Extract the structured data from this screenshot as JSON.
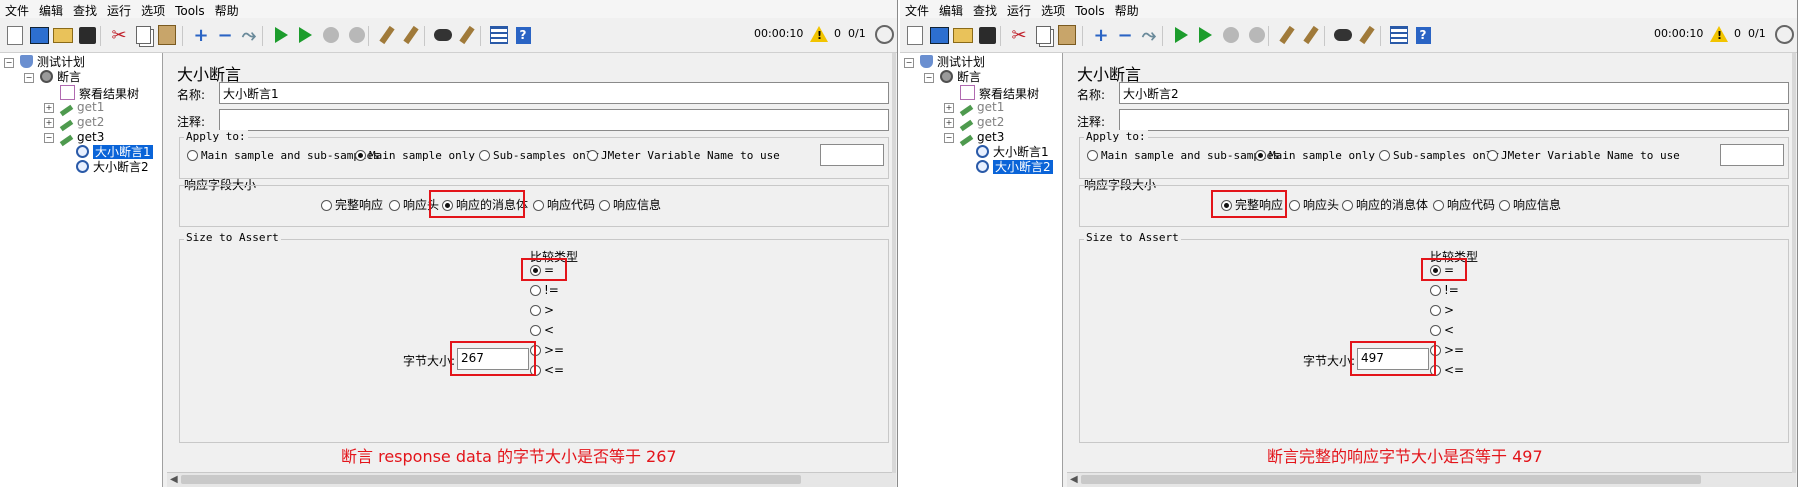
{
  "menu": [
    "文件",
    "编辑",
    "查找",
    "运行",
    "选项",
    "Tools",
    "帮助"
  ],
  "toolbar": {
    "timer": "00:00:10",
    "warnings": "0",
    "threads": "0/1"
  },
  "tree": {
    "test_plan": "测试计划",
    "assertion": "断言",
    "view_results": "察看结果树",
    "get1": "get1",
    "get2": "get2",
    "get3": "get3",
    "size_assert_1": "大小断言1",
    "size_assert_2": "大小断言2"
  },
  "labels": {
    "title": "大小断言",
    "name": "名称:",
    "comment": "注释:",
    "apply_to": "Apply to:",
    "apply_opts": [
      "Main sample and sub-samples",
      "Main sample only",
      "Sub-samples only",
      "JMeter Variable Name to use"
    ],
    "field_group": "响应字段大小",
    "field_opts": [
      "完整响应",
      "响应头",
      "响应的消息体",
      "响应代码",
      "响应信息"
    ],
    "size_group": "Size to Assert",
    "compare_type": "比较类型",
    "compare_opts": [
      "=",
      "!=",
      ">",
      "<",
      ">=",
      "<="
    ],
    "byte_size": "字节大小:"
  },
  "panels": [
    {
      "name_value": "大小断言1",
      "comment_value": "",
      "selected_node": "size_assert_1",
      "apply_selected": 1,
      "field_selected": 2,
      "compare_selected": 0,
      "size_value": "267",
      "note": "断言 response data 的字节大小是否等于 267"
    },
    {
      "name_value": "大小断言2",
      "comment_value": "",
      "selected_node": "size_assert_2",
      "apply_selected": 1,
      "field_selected": 0,
      "compare_selected": 0,
      "size_value": "497",
      "note": "断言完整的响应字节大小是否等于 497"
    }
  ],
  "colors": {
    "annotation_red": "#e3141a",
    "selection_blue": "#0a64d8",
    "run_green": "#1c9c2c"
  },
  "icons": [
    "new-icon",
    "templates-icon",
    "open-icon",
    "save-icon",
    "cut-icon",
    "copy-icon",
    "paste-icon",
    "expand-icon",
    "collapse-icon",
    "toggle-icon",
    "start-icon",
    "start-no-pause-icon",
    "stop-icon",
    "shutdown-icon",
    "clear-icon",
    "clear-all-icon",
    "search-icon",
    "reset-search-icon",
    "function-helper-icon",
    "help-icon",
    "warning-icon",
    "remote-globe-icon"
  ]
}
